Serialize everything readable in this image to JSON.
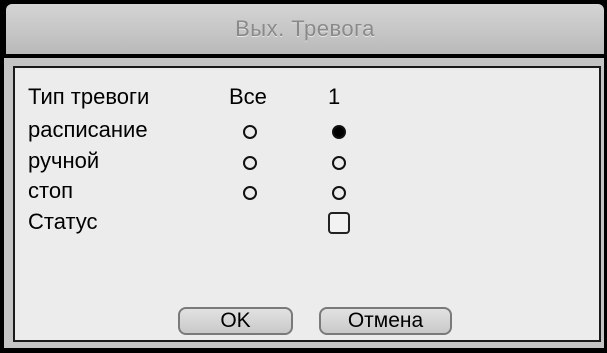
{
  "dialog": {
    "title": "Вых. Тревога"
  },
  "table": {
    "header": {
      "label": "Тип тревоги",
      "col_all": "Все",
      "col_1": "1"
    },
    "rows": [
      {
        "label": "расписание",
        "all_selected": false,
        "ch1_selected": true
      },
      {
        "label": "ручной",
        "all_selected": false,
        "ch1_selected": false
      },
      {
        "label": "стоп",
        "all_selected": false,
        "ch1_selected": false
      }
    ],
    "status": {
      "label": "Статус",
      "checked": false
    }
  },
  "buttons": {
    "ok": "OK",
    "cancel": "Отмена"
  }
}
